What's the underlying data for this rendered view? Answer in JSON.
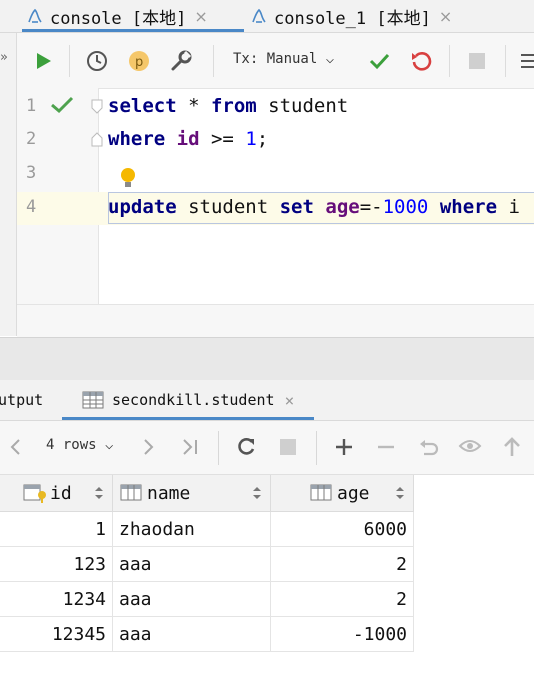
{
  "editor_tabs": [
    {
      "label": "console [本地]",
      "close": "×"
    },
    {
      "label": "console_1 [本地]",
      "close": "×"
    }
  ],
  "left_chevron": "»",
  "toolbar": {
    "transaction_label": "Tx: Manual",
    "transaction_arrow": "⌵",
    "icons": [
      "run-icon",
      "history-icon",
      "pin-icon",
      "settings-wrench-icon",
      "commit-icon",
      "rollback-icon",
      "stop-icon",
      "layout-icon"
    ]
  },
  "editor": {
    "line_numbers": [
      "1",
      "2",
      "3",
      "4"
    ],
    "lines": [
      {
        "t1": "select",
        "t2": " * ",
        "t3": "from",
        "t4": " student"
      },
      {
        "t1": "where",
        "t2": " ",
        "t3": "id",
        "t4": " >= ",
        "t5": "1",
        "t6": ";"
      },
      {},
      {
        "t1": "update",
        "t2": " student ",
        "t3": "set",
        "t4": " ",
        "t5": "age",
        "t6": "=-",
        "t7": "1000",
        "t8": " ",
        "t9": "where",
        "t10": " i"
      }
    ]
  },
  "result_tabs": [
    {
      "label": "Output"
    },
    {
      "label": "secondkill.student",
      "close": "×"
    }
  ],
  "grid_toolbar": {
    "rows_label": "4 rows",
    "rows_arrow": "⌵"
  },
  "table": {
    "columns": [
      "id",
      "name",
      "age"
    ],
    "rows": [
      {
        "id": "1",
        "name": "zhaodan",
        "age": "6000"
      },
      {
        "id": "123",
        "name": "aaa",
        "age": "2"
      },
      {
        "id": "1234",
        "name": "aaa",
        "age": "2"
      },
      {
        "id": "12345",
        "name": "aaa",
        "age": "-1000"
      }
    ]
  },
  "colors": {
    "accent": "#4a88c7",
    "run_green": "#3ca03c",
    "keyword": "#000080",
    "column": "#660e7a",
    "number": "#0000ff"
  }
}
